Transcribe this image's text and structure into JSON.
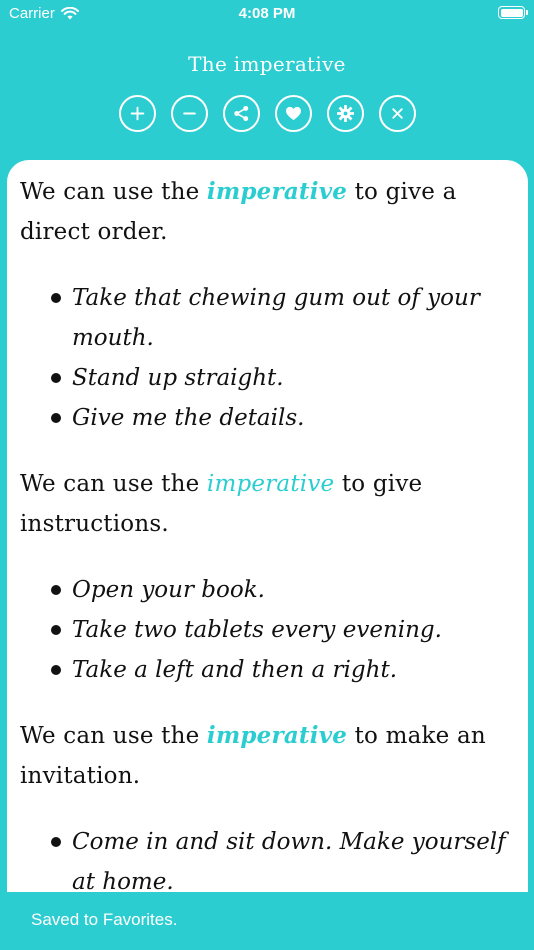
{
  "status_bar": {
    "carrier": "Carrier",
    "time": "4:08 PM"
  },
  "header": {
    "title": "The imperative"
  },
  "toolbar": {
    "buttons": [
      {
        "name": "zoom-in",
        "icon": "plus-icon"
      },
      {
        "name": "zoom-out",
        "icon": "minus-icon"
      },
      {
        "name": "share",
        "icon": "share-icon"
      },
      {
        "name": "favorite",
        "icon": "heart-icon"
      },
      {
        "name": "settings",
        "icon": "gear-icon"
      },
      {
        "name": "close",
        "icon": "close-icon"
      }
    ]
  },
  "content": {
    "sections": [
      {
        "intro_before": "We can use the ",
        "keyword": "imperative",
        "intro_after": " to give a direct order.",
        "examples": [
          "Take that chewing gum out of your mouth.",
          "Stand up straight.",
          "Give me the details."
        ]
      },
      {
        "intro_before": "We can use the ",
        "keyword": "imperative",
        "intro_after": " to give instructions.",
        "examples": [
          "Open your book.",
          "Take two tablets every evening.",
          "Take a left and then a right."
        ]
      },
      {
        "intro_before": "We can use the ",
        "keyword": "imperative",
        "intro_after": " to make an invitation.",
        "examples": [
          "Come in and sit down. Make yourself at home."
        ]
      }
    ]
  },
  "toast": {
    "message": "Saved to Favorites."
  },
  "colors": {
    "accent": "#2ccdd1",
    "card": "#ffffff",
    "text": "#111111"
  }
}
